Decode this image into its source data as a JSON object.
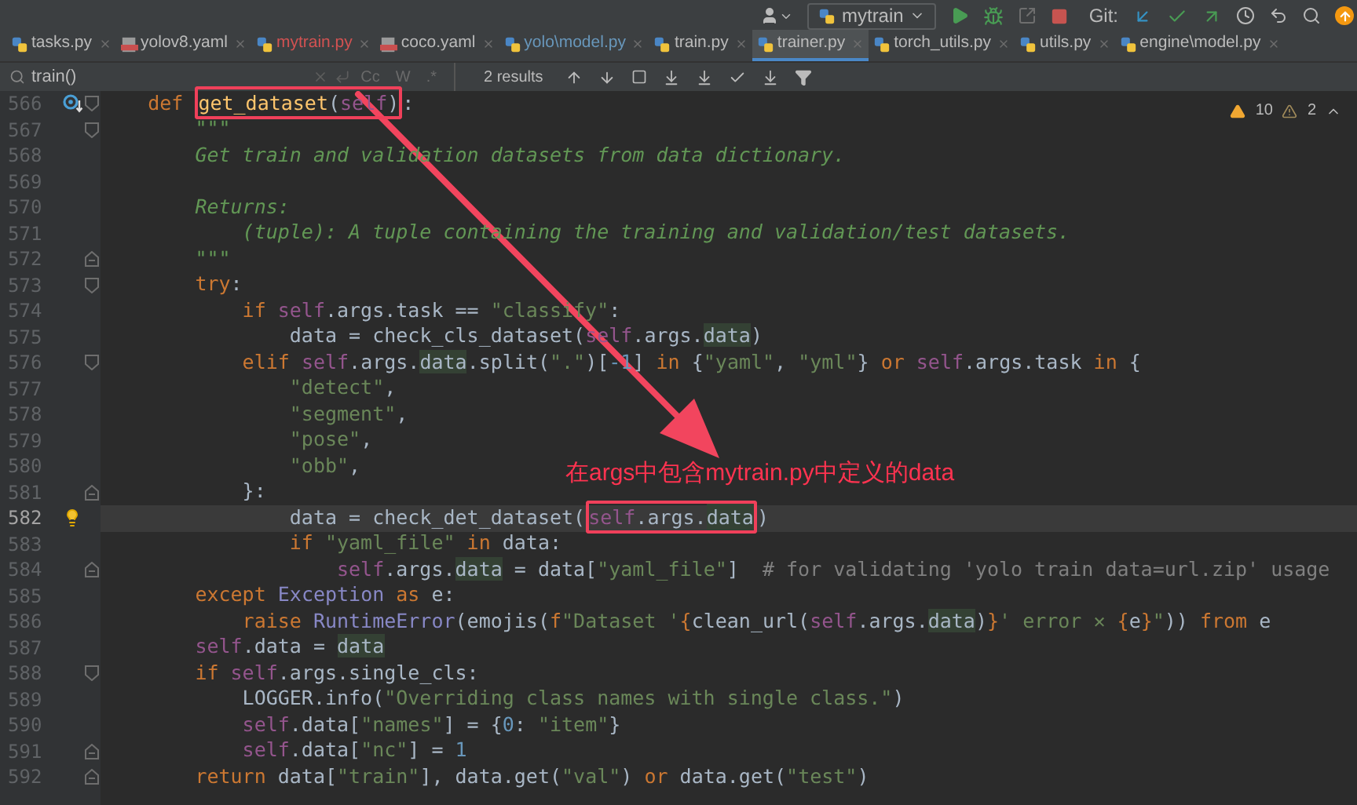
{
  "toolbar": {
    "run_config": "mytrain",
    "git_label": "Git:"
  },
  "tabs": [
    {
      "label": "tasks.py",
      "kind": "py",
      "color": "#bbbbbb",
      "selected": false
    },
    {
      "label": "yolov8.yaml",
      "kind": "yaml",
      "color": "#bbbbbb",
      "selected": false
    },
    {
      "label": "mytrain.py",
      "kind": "py",
      "color": "#d25252",
      "selected": false
    },
    {
      "label": "coco.yaml",
      "kind": "yaml",
      "color": "#bbbbbb",
      "selected": false
    },
    {
      "label": "yolo\\model.py",
      "kind": "py",
      "color": "#6897bb",
      "selected": false
    },
    {
      "label": "train.py",
      "kind": "py",
      "color": "#bbbbbb",
      "selected": false
    },
    {
      "label": "trainer.py",
      "kind": "py",
      "color": "#bbbbbb",
      "selected": true
    },
    {
      "label": "torch_utils.py",
      "kind": "py",
      "color": "#bbbbbb",
      "selected": false
    },
    {
      "label": "utils.py",
      "kind": "py",
      "color": "#bbbbbb",
      "selected": false
    },
    {
      "label": "engine\\model.py",
      "kind": "py",
      "color": "#bbbbbb",
      "selected": false
    }
  ],
  "search": {
    "value": "train()",
    "options": [
      "Cc",
      "W",
      ".*"
    ],
    "results": "2 results"
  },
  "inspections": {
    "warnings": "10",
    "weak_warnings": "2"
  },
  "lines": [
    {
      "number": "566",
      "gutter_icon": {
        "kind": "override"
      },
      "fold": {
        "kind": "start"
      },
      "current": false,
      "tokens": [
        {
          "kind": "kw",
          "text": "    def "
        },
        {
          "kind": "fn",
          "text": "get_dataset",
          "framed": true
        },
        {
          "kind": "p",
          "text": "(",
          "framed": true
        },
        {
          "kind": "self",
          "text": "self",
          "framed": true
        },
        {
          "kind": "p",
          "text": ")",
          "framed": true
        },
        {
          "kind": "p",
          "text": ":"
        }
      ]
    },
    {
      "number": "567",
      "fold": {
        "kind": "start"
      },
      "current": false,
      "tokens": [
        {
          "kind": "doc",
          "text": "        \"\"\""
        }
      ]
    },
    {
      "number": "568",
      "current": false,
      "tokens": [
        {
          "kind": "doc",
          "text": "        Get train and validation datasets from data dictionary."
        }
      ]
    },
    {
      "number": "569",
      "current": false
    },
    {
      "number": "570",
      "current": false,
      "tokens": [
        {
          "kind": "doc",
          "text": "        Returns:"
        }
      ]
    },
    {
      "number": "571",
      "current": false,
      "tokens": [
        {
          "kind": "doc",
          "text": "            (tuple): A tuple containing the training and validation/test datasets."
        }
      ]
    },
    {
      "number": "572",
      "fold": {
        "kind": "end"
      },
      "current": false,
      "tokens": [
        {
          "kind": "doc",
          "text": "        \"\"\""
        }
      ]
    },
    {
      "number": "573",
      "fold": {
        "kind": "start"
      },
      "current": false,
      "tokens": [
        {
          "kind": "kw",
          "text": "        try"
        },
        {
          "kind": "p",
          "text": ":"
        }
      ]
    },
    {
      "number": "574",
      "current": false,
      "tokens": [
        {
          "kind": "kw",
          "text": "            if "
        },
        {
          "kind": "self",
          "text": "self"
        },
        {
          "kind": "p",
          "text": ".args.task == "
        },
        {
          "kind": "str",
          "text": "\"classify\""
        },
        {
          "kind": "p",
          "text": ":"
        }
      ]
    },
    {
      "number": "575",
      "current": false,
      "tokens": [
        {
          "kind": "p",
          "text": "                data = check_cls_dataset("
        },
        {
          "kind": "self",
          "text": "self"
        },
        {
          "kind": "p",
          "text": ".args."
        },
        {
          "kind": "hl",
          "text": "data"
        },
        {
          "kind": "p",
          "text": ")"
        }
      ]
    },
    {
      "number": "576",
      "fold": {
        "kind": "start"
      },
      "current": false,
      "tokens": [
        {
          "kind": "kw",
          "text": "            elif "
        },
        {
          "kind": "self",
          "text": "self"
        },
        {
          "kind": "p",
          "text": ".args."
        },
        {
          "kind": "hl",
          "text": "data"
        },
        {
          "kind": "p",
          "text": ".split("
        },
        {
          "kind": "str",
          "text": "\".\""
        },
        {
          "kind": "p",
          "text": ")["
        },
        {
          "kind": "num",
          "text": "-1"
        },
        {
          "kind": "p",
          "text": "] "
        },
        {
          "kind": "kw",
          "text": "in"
        },
        {
          "kind": "p",
          "text": " {"
        },
        {
          "kind": "str",
          "text": "\"yaml\""
        },
        {
          "kind": "p",
          "text": ", "
        },
        {
          "kind": "str",
          "text": "\"yml\""
        },
        {
          "kind": "p",
          "text": "} "
        },
        {
          "kind": "kw",
          "text": "or "
        },
        {
          "kind": "self",
          "text": "self"
        },
        {
          "kind": "p",
          "text": ".args.task "
        },
        {
          "kind": "kw",
          "text": "in"
        },
        {
          "kind": "p",
          "text": " {"
        }
      ]
    },
    {
      "number": "577",
      "current": false,
      "tokens": [
        {
          "kind": "str",
          "text": "                \"detect\""
        },
        {
          "kind": "p",
          "text": ","
        }
      ]
    },
    {
      "number": "578",
      "current": false,
      "tokens": [
        {
          "kind": "str",
          "text": "                \"segment\""
        },
        {
          "kind": "p",
          "text": ","
        }
      ]
    },
    {
      "number": "579",
      "current": false,
      "tokens": [
        {
          "kind": "str",
          "text": "                \"pose\""
        },
        {
          "kind": "p",
          "text": ","
        }
      ]
    },
    {
      "number": "580",
      "current": false,
      "tokens": [
        {
          "kind": "str",
          "text": "                \"obb\""
        },
        {
          "kind": "p",
          "text": ","
        }
      ]
    },
    {
      "number": "581",
      "fold": {
        "kind": "end"
      },
      "current": false,
      "tokens": [
        {
          "kind": "p",
          "text": "            }:"
        }
      ]
    },
    {
      "number": "582",
      "gutter_icon": {
        "kind": "bulb"
      },
      "current": true,
      "tokens": [
        {
          "kind": "p",
          "text": "                data = check_det_dataset("
        },
        {
          "kind": "self",
          "text": "self",
          "framed": true
        },
        {
          "kind": "p",
          "text": ".args.",
          "framed": true
        },
        {
          "kind": "hl",
          "text": "data",
          "framed": true
        },
        {
          "kind": "p",
          "text": ")"
        }
      ]
    },
    {
      "number": "583",
      "current": false,
      "tokens": [
        {
          "kind": "kw",
          "text": "                if "
        },
        {
          "kind": "str",
          "text": "\"yaml_file\""
        },
        {
          "kind": "kw",
          "text": " in"
        },
        {
          "kind": "p",
          "text": " data:"
        }
      ]
    },
    {
      "number": "584",
      "fold": {
        "kind": "end"
      },
      "current": false,
      "tokens": [
        {
          "kind": "self",
          "text": "                    self"
        },
        {
          "kind": "p",
          "text": ".args."
        },
        {
          "kind": "hl",
          "text": "data"
        },
        {
          "kind": "p",
          "text": " = data["
        },
        {
          "kind": "str",
          "text": "\"yaml_file\""
        },
        {
          "kind": "p",
          "text": "]  "
        },
        {
          "kind": "cm",
          "text": "# for validating 'yolo train data=url.zip' usage"
        }
      ]
    },
    {
      "number": "585",
      "current": false,
      "tokens": [
        {
          "kind": "kw",
          "text": "        except "
        },
        {
          "kind": "bi",
          "text": "Exception"
        },
        {
          "kind": "kw",
          "text": " as"
        },
        {
          "kind": "p",
          "text": " e:"
        }
      ]
    },
    {
      "number": "586",
      "current": false,
      "tokens": [
        {
          "kind": "kw",
          "text": "            raise "
        },
        {
          "kind": "bi",
          "text": "RuntimeError"
        },
        {
          "kind": "p",
          "text": "(emojis("
        },
        {
          "kind": "kw",
          "text": "f"
        },
        {
          "kind": "str",
          "text": "\"Dataset '"
        },
        {
          "kind": "kw",
          "text": "{"
        },
        {
          "kind": "p",
          "text": "clean_url("
        },
        {
          "kind": "self",
          "text": "self"
        },
        {
          "kind": "p",
          "text": ".args."
        },
        {
          "kind": "hl",
          "text": "data"
        },
        {
          "kind": "p",
          "text": ")"
        },
        {
          "kind": "kw",
          "text": "}"
        },
        {
          "kind": "str",
          "text": "' error ✕ "
        },
        {
          "kind": "kw",
          "text": "{"
        },
        {
          "kind": "p",
          "text": "e"
        },
        {
          "kind": "kw",
          "text": "}"
        },
        {
          "kind": "str",
          "text": "\""
        },
        {
          "kind": "p",
          "text": ")) "
        },
        {
          "kind": "kw",
          "text": "from"
        },
        {
          "kind": "p",
          "text": " e"
        }
      ]
    },
    {
      "number": "587",
      "current": false,
      "tokens": [
        {
          "kind": "self",
          "text": "        self"
        },
        {
          "kind": "p",
          "text": ".data = "
        },
        {
          "kind": "hl",
          "text": "data"
        }
      ]
    },
    {
      "number": "588",
      "fold": {
        "kind": "start"
      },
      "current": false,
      "tokens": [
        {
          "kind": "kw",
          "text": "        if "
        },
        {
          "kind": "self",
          "text": "self"
        },
        {
          "kind": "p",
          "text": ".args.single_cls:"
        }
      ]
    },
    {
      "number": "589",
      "current": false,
      "tokens": [
        {
          "kind": "p",
          "text": "            LOGGER.info("
        },
        {
          "kind": "str",
          "text": "\"Overriding class names with single class.\""
        },
        {
          "kind": "p",
          "text": ")"
        }
      ]
    },
    {
      "number": "590",
      "current": false,
      "tokens": [
        {
          "kind": "self",
          "text": "            self"
        },
        {
          "kind": "p",
          "text": ".data["
        },
        {
          "kind": "str",
          "text": "\"names\""
        },
        {
          "kind": "p",
          "text": "] = {"
        },
        {
          "kind": "num",
          "text": "0"
        },
        {
          "kind": "p",
          "text": ": "
        },
        {
          "kind": "str",
          "text": "\"item\""
        },
        {
          "kind": "p",
          "text": "}"
        }
      ]
    },
    {
      "number": "591",
      "fold": {
        "kind": "end"
      },
      "current": false,
      "tokens": [
        {
          "kind": "self",
          "text": "            self"
        },
        {
          "kind": "p",
          "text": ".data["
        },
        {
          "kind": "str",
          "text": "\"nc\""
        },
        {
          "kind": "p",
          "text": "] = "
        },
        {
          "kind": "num",
          "text": "1"
        }
      ]
    },
    {
      "number": "592",
      "fold": {
        "kind": "end"
      },
      "current": false,
      "tokens": [
        {
          "kind": "kw",
          "text": "        return"
        },
        {
          "kind": "p",
          "text": " data["
        },
        {
          "kind": "str",
          "text": "\"train\""
        },
        {
          "kind": "p",
          "text": "], data.get("
        },
        {
          "kind": "str",
          "text": "\"val\""
        },
        {
          "kind": "p",
          "text": ") "
        },
        {
          "kind": "kw",
          "text": "or"
        },
        {
          "kind": "p",
          "text": " data.get("
        },
        {
          "kind": "str",
          "text": "\"test\""
        },
        {
          "kind": "p",
          "text": ")"
        }
      ]
    }
  ],
  "annotation": {
    "text": "在args中包含mytrain.py中定义的data"
  }
}
